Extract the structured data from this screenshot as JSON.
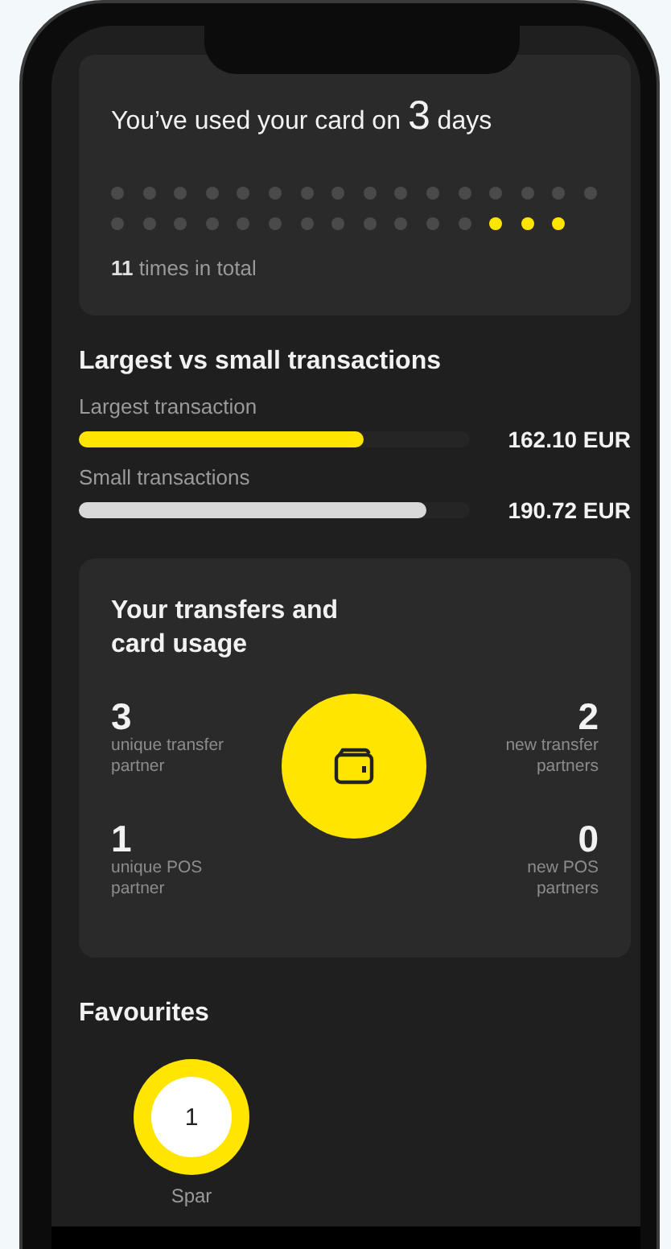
{
  "usage_card": {
    "title_before": "You’ve used your card on",
    "count": "3",
    "title_after": "days",
    "days": [
      {
        "used": false
      },
      {
        "used": false
      },
      {
        "used": false
      },
      {
        "used": false
      },
      {
        "used": false
      },
      {
        "used": false
      },
      {
        "used": false
      },
      {
        "used": false
      },
      {
        "used": false
      },
      {
        "used": false
      },
      {
        "used": false
      },
      {
        "used": false
      },
      {
        "used": false
      },
      {
        "used": false
      },
      {
        "used": false
      },
      {
        "used": false
      },
      {
        "used": false
      },
      {
        "used": false
      },
      {
        "used": false
      },
      {
        "used": false
      },
      {
        "used": false
      },
      {
        "used": false
      },
      {
        "used": false
      },
      {
        "used": false
      },
      {
        "used": false
      },
      {
        "used": false
      },
      {
        "used": false
      },
      {
        "used": false
      },
      {
        "used": true
      },
      {
        "used": true
      },
      {
        "used": true
      }
    ],
    "total": "**11** times in total"
  },
  "transactions": {
    "title": "Largest vs small transactions",
    "bars": [
      {
        "label": "Largest transaction",
        "level": 0.73,
        "amount": "162.10 EUR",
        "color": "#ffe500"
      },
      {
        "label": "Small transactions",
        "level": 0.89,
        "amount": "190.72 EUR",
        "color": "#d9d9d9"
      }
    ]
  },
  "transfers_card": {
    "title": "Your transfers and card usage",
    "stats": [
      {
        "value": "3",
        "label": "unique transfer partner"
      },
      {
        "value": "2",
        "label": "new transfer partners"
      },
      {
        "value": "1",
        "label": "unique POS partner"
      },
      {
        "value": "0",
        "label": "new POS partners"
      }
    ]
  },
  "favourites": {
    "title": "Favourites",
    "items": [
      {
        "count": "1",
        "name": "Spar"
      }
    ]
  }
}
